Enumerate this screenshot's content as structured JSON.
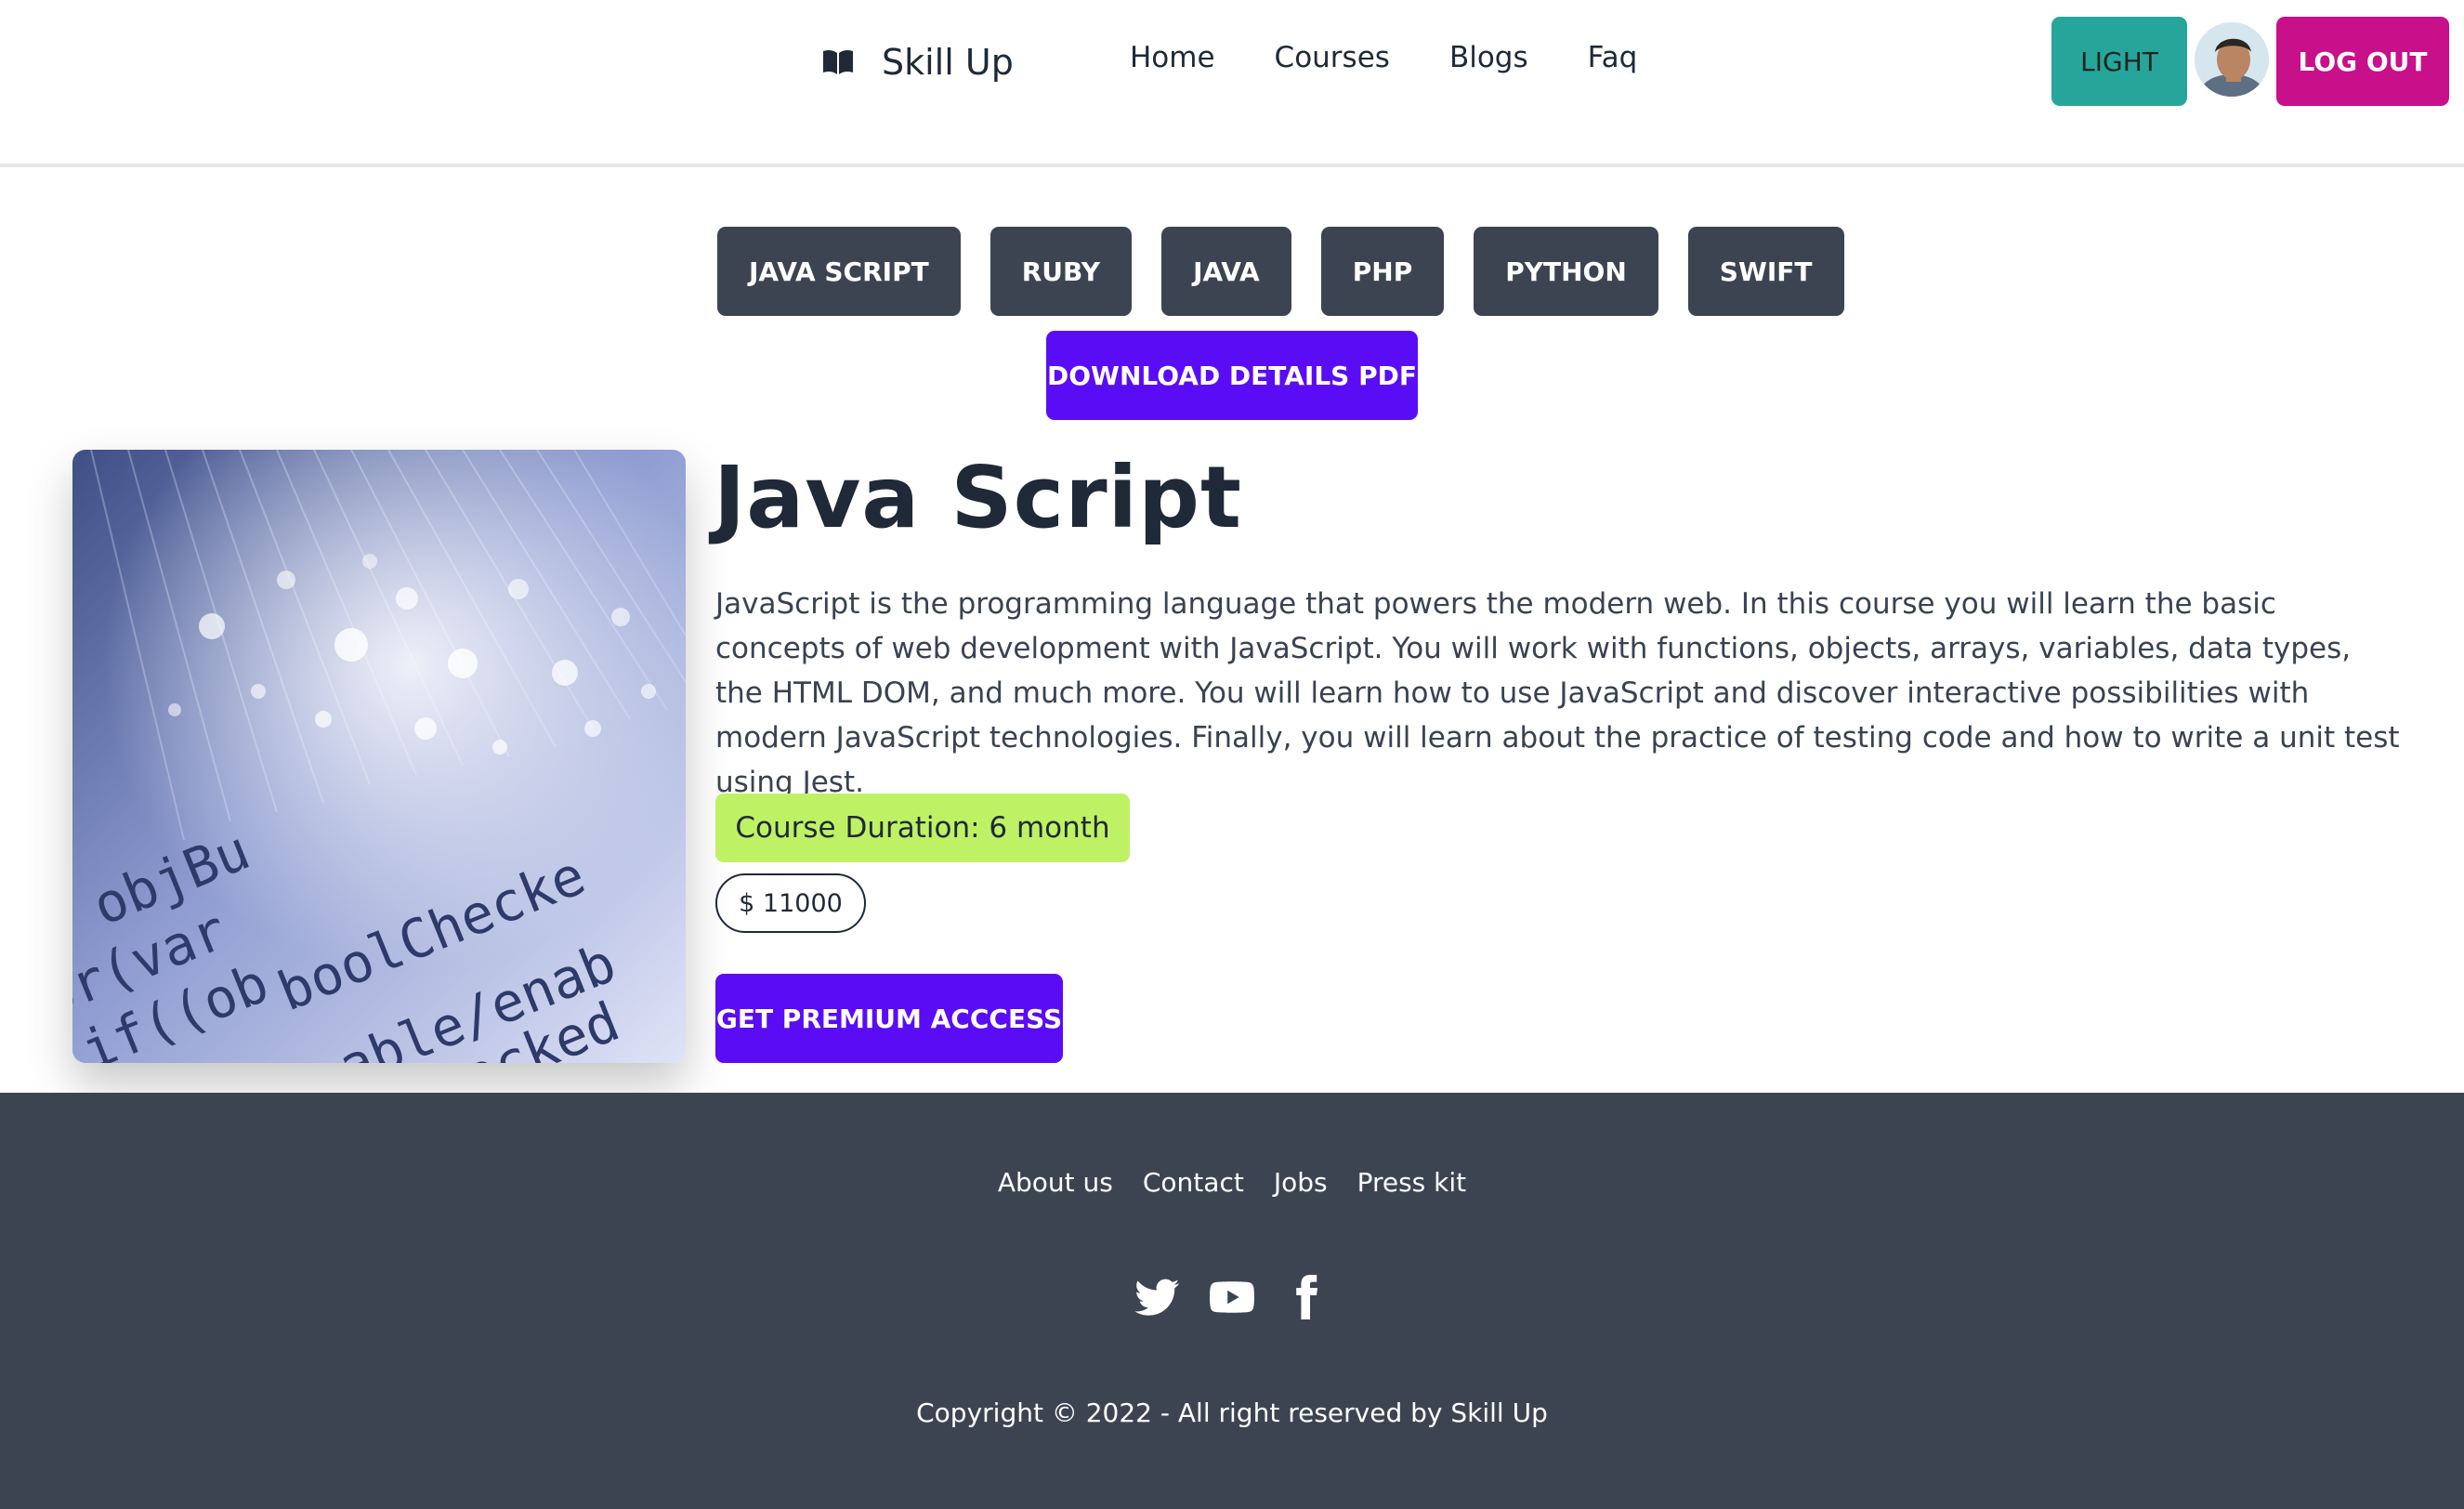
{
  "navbar": {
    "brand": "Skill Up",
    "links": [
      "Home",
      "Courses",
      "Blogs",
      "Faq"
    ],
    "theme_button": "LIGHT",
    "logout_button": "LOG OUT"
  },
  "categories": [
    "JAVA SCRIPT",
    "RUBY",
    "JAVA",
    "PHP",
    "PYTHON",
    "SWIFT"
  ],
  "download_button": "DOWNLOAD DETAILS PDF",
  "course": {
    "title": "Java Script",
    "description": "JavaScript is the programming language that powers the modern web. In this course you will learn the basic concepts of web development with JavaScript. You will work with functions, objects, arrays, variables, data types, the HTML DOM, and much more. You will learn how to use JavaScript and discover interactive possibilities with modern JavaScript technologies. Finally, you will learn about the practice of testing code and how to write a unit test using Jest.",
    "duration": "Course Duration: 6 month",
    "price": "$ 11000",
    "premium_button": "GET PREMIUM ACCCESS",
    "image_text": [
      "r objBu",
      "or(var",
      "if((ob",
      "boolChecke",
      "able/enab",
      "checked"
    ]
  },
  "footer": {
    "links": [
      "About us",
      "Contact",
      "Jobs",
      "Press kit"
    ],
    "social": [
      "twitter-icon",
      "youtube-icon",
      "facebook-icon"
    ],
    "copyright": "Copyright © 2022 - All right reserved by Skill Up"
  },
  "colors": {
    "chip_bg": "#3d4451",
    "primary": "#5a0cf5",
    "theme_button": "#26a69a",
    "logout_button": "#c8108a",
    "duration_bg": "#bef264",
    "footer_bg": "#3d4451"
  }
}
